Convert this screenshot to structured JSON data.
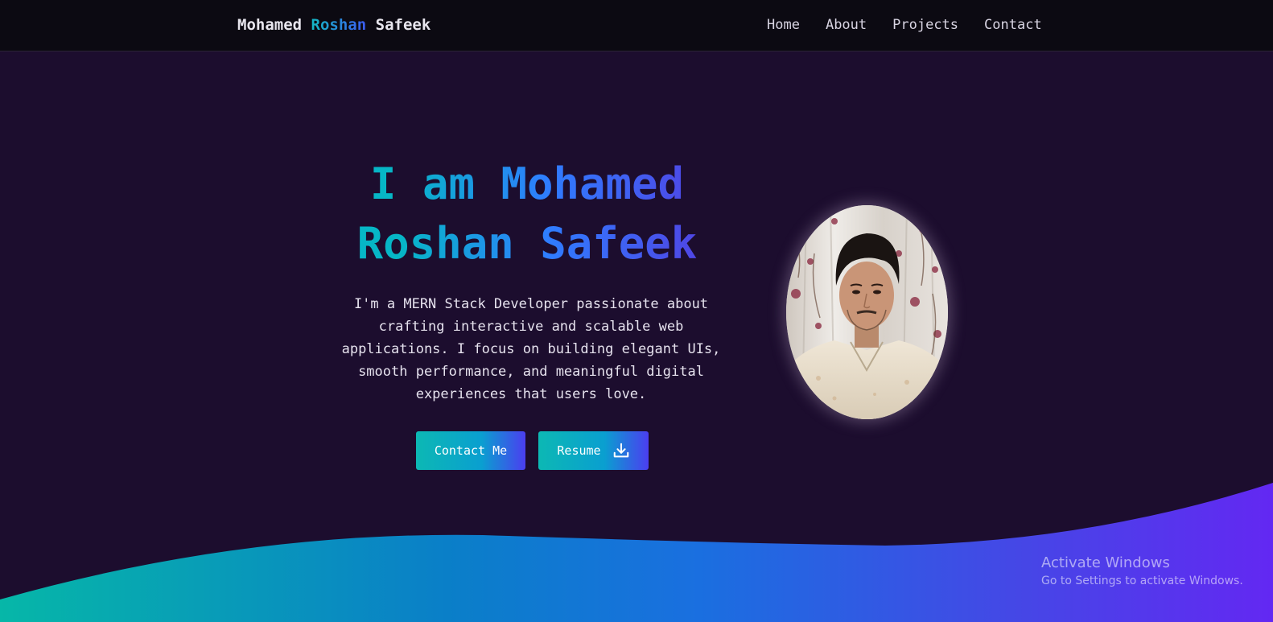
{
  "navbar": {
    "brand": {
      "first": "Mohamed",
      "middle": "Roshan",
      "last": "Safeek"
    },
    "links": [
      {
        "label": "Home"
      },
      {
        "label": "About"
      },
      {
        "label": "Projects"
      },
      {
        "label": "Contact"
      }
    ]
  },
  "hero": {
    "title_line1": "I am Mohamed",
    "title_line2": "Roshan Safeek",
    "description": "I'm a MERN Stack Developer passionate about crafting interactive and scalable web applications. I focus on building elegant UIs, smooth performance, and meaningful digital experiences that users love.",
    "contact_button": "Contact Me",
    "resume_button": "Resume",
    "resume_icon": "download-icon",
    "avatar_icon": "profile-photo"
  },
  "colors": {
    "background": "#1c0d2e",
    "navbar": "#0c0a12",
    "accent_start": "#06b6c6",
    "accent_mid": "#2f7dff",
    "accent_end": "#5b2bf0"
  },
  "watermark": {
    "title": "Activate Windows",
    "subtitle": "Go to Settings to activate Windows."
  }
}
